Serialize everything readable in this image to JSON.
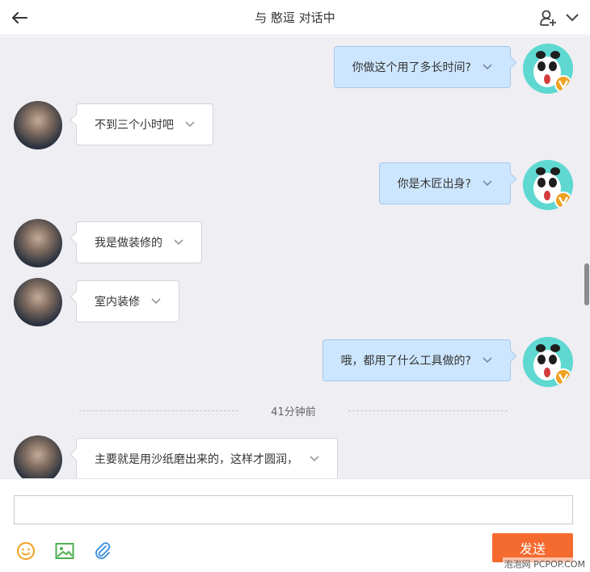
{
  "header": {
    "title": "与 憨逗 对话中",
    "back_icon": "arrow-left-icon",
    "contact_icon": "user-add-icon",
    "menu_icon": "chevron-down-icon"
  },
  "messages": [
    {
      "side": "me",
      "text": "你做这个用了多长时间?"
    },
    {
      "side": "other",
      "text": "不到三个小时吧"
    },
    {
      "side": "me",
      "text": "你是木匠出身?"
    },
    {
      "side": "other",
      "text": "我是做装修的"
    },
    {
      "side": "other",
      "text": "室内装修"
    },
    {
      "side": "me",
      "text": "哦，都用了什么工具做的?"
    },
    {
      "side": "other",
      "text": "主要就是用沙纸磨出来的，这样才圆润，"
    }
  ],
  "divider_time": "41分钟前",
  "composer": {
    "input_value": "",
    "send_label": "发送",
    "tools": [
      "emoji-icon",
      "image-icon",
      "attachment-icon"
    ]
  },
  "watermark": "泡泡网 PCPOP.COM",
  "colors": {
    "chat_bg": "#eeeef3",
    "my_bubble": "#cde6ff",
    "their_bubble": "#ffffff",
    "send_button": "#f56a2f",
    "verified_badge": "#f0a020"
  }
}
